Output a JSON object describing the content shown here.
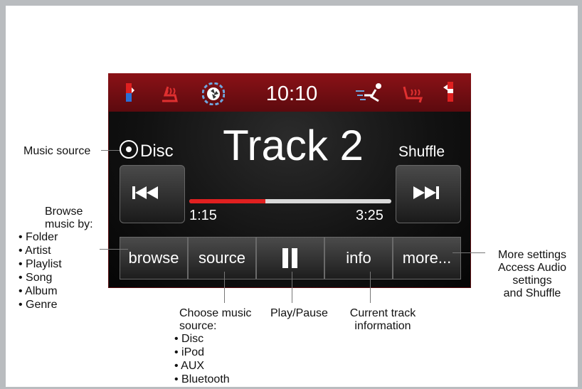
{
  "screen": {
    "clock": "10:10",
    "source_label": "Disc",
    "track_title": "Track 2",
    "shuffle_label": "Shuffle",
    "elapsed": "1:15",
    "total": "3:25",
    "progress_fraction": 0.375,
    "accent_color": "#e02020",
    "status_bar_color": "#7a1015",
    "buttons": [
      {
        "label": "browse"
      },
      {
        "label": "source"
      },
      {
        "label": "",
        "icon": "pause-icon"
      },
      {
        "label": "info"
      },
      {
        "label": "more..."
      }
    ],
    "status_icons": [
      "temperature-left-icon",
      "heated-seat-left-icon",
      "fan-icon",
      "airflow-icon",
      "heated-seat-right-icon",
      "temperature-right-icon"
    ]
  },
  "callouts": {
    "music_source": "Music source",
    "browse_heading_1": "Browse",
    "browse_heading_2": "music by:",
    "browse_items": [
      "Folder",
      "Artist",
      "Playlist",
      "Song",
      "Album",
      "Genre"
    ],
    "choose_source_1": "Choose music",
    "choose_source_2": "source:",
    "source_items": [
      "Disc",
      "iPod",
      "AUX",
      "Bluetooth"
    ],
    "play_pause": "Play/Pause",
    "current_track_1": "Current track",
    "current_track_2": "information",
    "more_settings_1": "More settings",
    "more_settings_2": "Access Audio",
    "more_settings_3": "settings",
    "more_settings_4": "and Shuffle"
  }
}
